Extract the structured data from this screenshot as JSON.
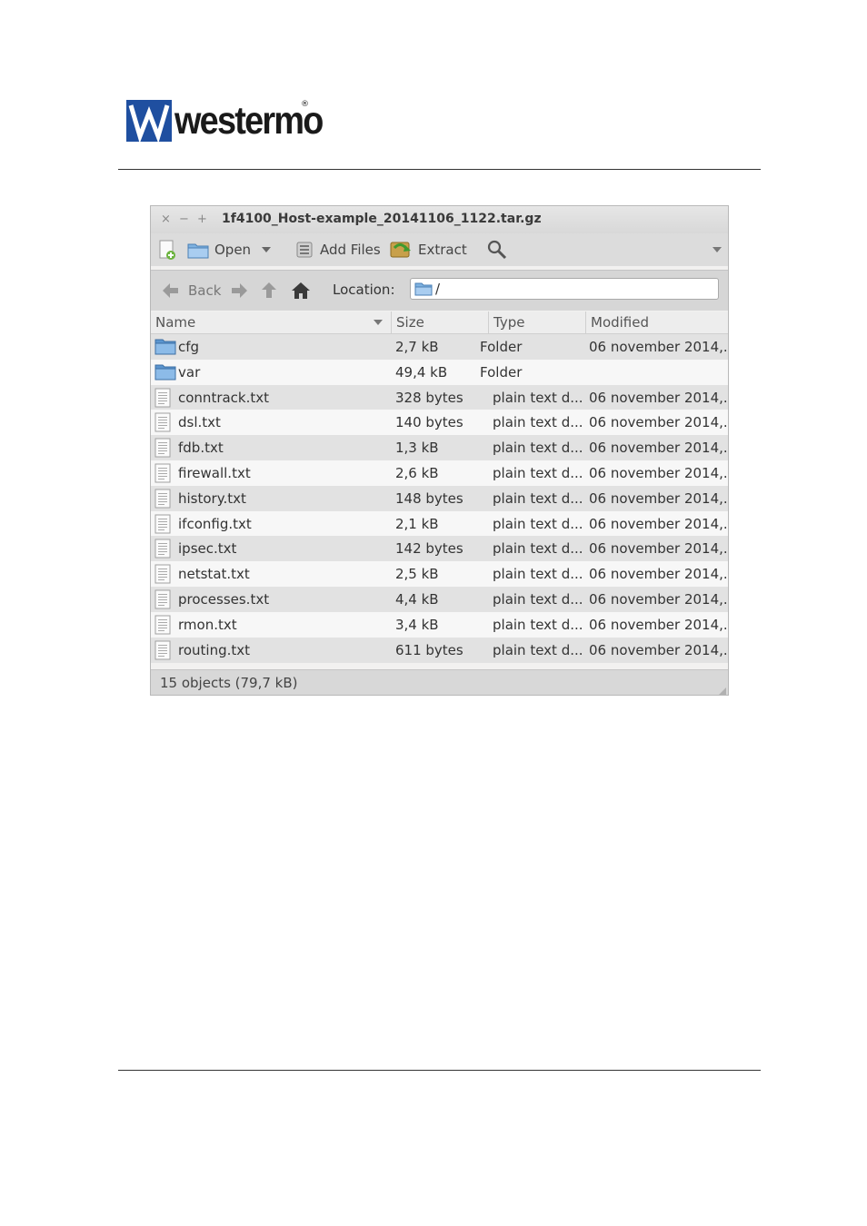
{
  "logo": {
    "text": "westermo",
    "reg": "®"
  },
  "window": {
    "title": "1f4100_Host-example_20141106_1122.tar.gz",
    "controls": {
      "close": "×",
      "minimize": "−",
      "maximize": "+"
    }
  },
  "toolbar": {
    "open_label": "Open",
    "add_files_label": "Add Files",
    "extract_label": "Extract"
  },
  "location_bar": {
    "back_label": "Back",
    "location_label": "Location:",
    "path": "/"
  },
  "columns": {
    "name": "Name",
    "size": "Size",
    "type": "Type",
    "modified": "Modified"
  },
  "files": [
    {
      "name": "cfg",
      "size": "2,7 kB",
      "type": "Folder",
      "modified": "06 november 2014,...",
      "kind": "folder"
    },
    {
      "name": "var",
      "size": "49,4 kB",
      "type": "Folder",
      "modified": "",
      "kind": "folder"
    },
    {
      "name": "conntrack.txt",
      "size": "328 bytes",
      "type": "plain text d...",
      "modified": "06 november 2014,...",
      "kind": "file"
    },
    {
      "name": "dsl.txt",
      "size": "140 bytes",
      "type": "plain text d...",
      "modified": "06 november 2014,...",
      "kind": "file"
    },
    {
      "name": "fdb.txt",
      "size": "1,3 kB",
      "type": "plain text d...",
      "modified": "06 november 2014,...",
      "kind": "file"
    },
    {
      "name": "firewall.txt",
      "size": "2,6 kB",
      "type": "plain text d...",
      "modified": "06 november 2014,...",
      "kind": "file"
    },
    {
      "name": "history.txt",
      "size": "148 bytes",
      "type": "plain text d...",
      "modified": "06 november 2014,...",
      "kind": "file"
    },
    {
      "name": "ifconfig.txt",
      "size": "2,1 kB",
      "type": "plain text d...",
      "modified": "06 november 2014,...",
      "kind": "file"
    },
    {
      "name": "ipsec.txt",
      "size": "142 bytes",
      "type": "plain text d...",
      "modified": "06 november 2014,...",
      "kind": "file"
    },
    {
      "name": "netstat.txt",
      "size": "2,5 kB",
      "type": "plain text d...",
      "modified": "06 november 2014,...",
      "kind": "file"
    },
    {
      "name": "processes.txt",
      "size": "4,4 kB",
      "type": "plain text d...",
      "modified": "06 november 2014,...",
      "kind": "file"
    },
    {
      "name": "rmon.txt",
      "size": "3,4 kB",
      "type": "plain text d...",
      "modified": "06 november 2014,...",
      "kind": "file"
    },
    {
      "name": "routing.txt",
      "size": "611 bytes",
      "type": "plain text d...",
      "modified": "06 november 2014,...",
      "kind": "file"
    }
  ],
  "status": "15 objects (79,7 kB)",
  "colors": {
    "brand_blue": "#1f4fa0",
    "folder_blue": "#6fa8dc",
    "row_alt": "#e2e2e2"
  }
}
